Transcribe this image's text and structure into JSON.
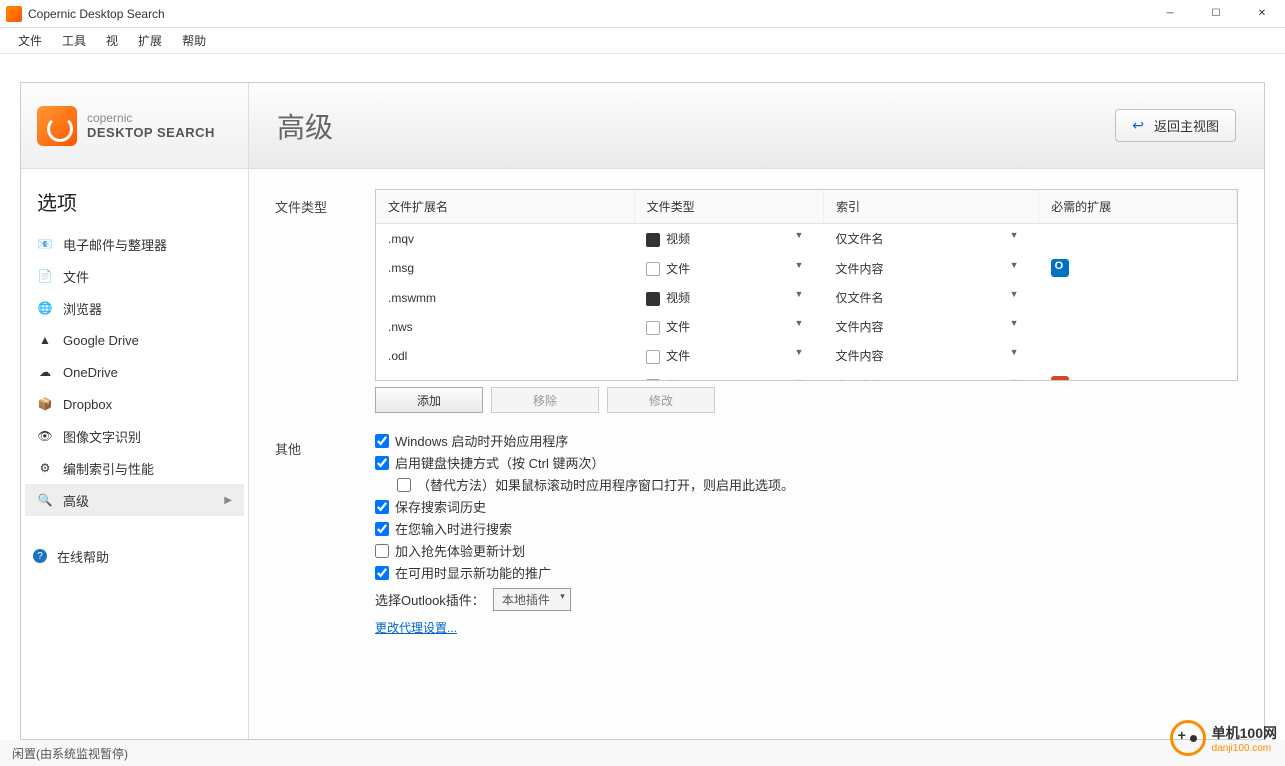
{
  "window": {
    "title": "Copernic Desktop Search"
  },
  "menu": [
    "文件",
    "工具",
    "视",
    "扩展",
    "帮助"
  ],
  "logo": {
    "line1": "copernic",
    "line2": "DESKTOP SEARCH"
  },
  "sidebar": {
    "title": "选项",
    "items": [
      {
        "icon": "📧",
        "label": "电子邮件与整理器"
      },
      {
        "icon": "📄",
        "label": "文件"
      },
      {
        "icon": "🌐",
        "label": "浏览器"
      },
      {
        "icon": "▲",
        "label": "Google Drive"
      },
      {
        "icon": "☁",
        "label": "OneDrive"
      },
      {
        "icon": "📦",
        "label": "Dropbox"
      },
      {
        "icon": "👁",
        "label": "图像文字识别"
      },
      {
        "icon": "⚙",
        "label": "编制索引与性能"
      },
      {
        "icon": "🔍",
        "label": "高级",
        "active": true
      }
    ],
    "help": {
      "icon": "?",
      "label": "在线帮助"
    }
  },
  "page": {
    "title": "高级",
    "back_label": "返回主视图"
  },
  "filetypes": {
    "section_label": "文件类型",
    "columns": [
      "文件扩展名",
      "文件类型",
      "索引",
      "必需的扩展"
    ],
    "rows": [
      {
        "ext": ".mqv",
        "type": "视频",
        "type_kind": "video",
        "index": "仅文件名",
        "req": ""
      },
      {
        "ext": ".msg",
        "type": "文件",
        "type_kind": "file",
        "index": "文件内容",
        "req": "outlook"
      },
      {
        "ext": ".mswmm",
        "type": "视频",
        "type_kind": "video",
        "index": "仅文件名",
        "req": ""
      },
      {
        "ext": ".nws",
        "type": "文件",
        "type_kind": "file",
        "index": "文件内容",
        "req": ""
      },
      {
        "ext": ".odl",
        "type": "文件",
        "type_kind": "file",
        "index": "文件内容",
        "req": ""
      },
      {
        "ext": ".odp",
        "type": "文件",
        "type_kind": "file",
        "index": "文件内容",
        "req": "ppt"
      }
    ],
    "buttons": {
      "add": "添加",
      "remove": "移除",
      "edit": "修改"
    }
  },
  "other": {
    "section_label": "其他",
    "checks": [
      {
        "checked": true,
        "label": "Windows 启动时开始应用程序"
      },
      {
        "checked": true,
        "label": "启用键盘快捷方式（按 Ctrl 键两次）"
      },
      {
        "checked": false,
        "label": "（替代方法）如果鼠标滚动时应用程序窗口打开，则启用此选项。",
        "indent": true
      },
      {
        "checked": true,
        "label": "保存搜索词历史"
      },
      {
        "checked": true,
        "label": "在您输入时进行搜索"
      },
      {
        "checked": false,
        "label": "加入抢先体验更新计划"
      },
      {
        "checked": true,
        "label": "在可用时显示新功能的推广"
      }
    ],
    "outlook_label": "选择Outlook插件：",
    "outlook_value": "本地插件",
    "proxy_link": "更改代理设置..."
  },
  "status": "闲置(由系统监视暂停)",
  "watermark": {
    "name": "单机100网",
    "url": "danji100.com"
  }
}
